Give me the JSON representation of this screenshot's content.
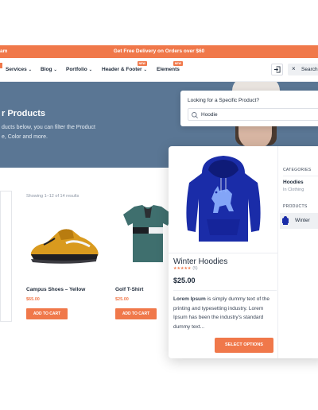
{
  "colors": {
    "accent": "#f0784a",
    "hero": "#5a7694",
    "dark_text": "#1e2a3a",
    "hoodie_blue": "#1a2ca8"
  },
  "promo": {
    "left_text": "am",
    "center_text": "Get Free Delivery on Orders over $60"
  },
  "nav": {
    "items": [
      {
        "label": "Services",
        "chevron": true,
        "badge": ""
      },
      {
        "label": "Blog",
        "chevron": true,
        "badge": ""
      },
      {
        "label": "Portfolio",
        "chevron": true,
        "badge": ""
      },
      {
        "label": "Header & Footer",
        "chevron": true,
        "badge": "NEW"
      },
      {
        "label": "Elements",
        "chevron": false,
        "badge": "NEW"
      }
    ],
    "login_icon": "login-icon",
    "search_label": "Search",
    "close_icon": "close-icon"
  },
  "hero": {
    "title": "r Products",
    "desc_line1": "ducts below, you can filter the Product",
    "desc_line2": "e, Color and more."
  },
  "search_panel": {
    "label": "Looking for a Specific Product?",
    "value": "Hoodie",
    "icon": "search-icon"
  },
  "listing": {
    "result_count": "Showing 1–12 of 14 results",
    "products": [
      {
        "name": "Campus Shoes – Yellow",
        "price": "$65.00",
        "button": "ADD TO CART"
      },
      {
        "name": "Golf T-Shirt",
        "price": "$25.00",
        "button": "ADD TO CART"
      }
    ]
  },
  "quick_view": {
    "title": "Winter Hoodies",
    "stars": "★★★★★",
    "rating_count": "(5)",
    "price": "$25.00",
    "description": "Lorem Ipsum is simply dummy text of the printing and typesetting industry. Lorem Ipsum has been the industry's standard dummy text...",
    "description_lead": "Lorem Ipsum",
    "description_rest": " is simply dummy text of the printing and typesetting industry. Lorem Ipsum has been the industry's standard dummy text...",
    "select_button": "SELECT OPTIONS",
    "categories_heading": "CATEGORIES",
    "category_name": "Hoodies",
    "category_sub": "In Clothing",
    "products_heading": "PRODUCTS",
    "product_item": "Winter"
  }
}
